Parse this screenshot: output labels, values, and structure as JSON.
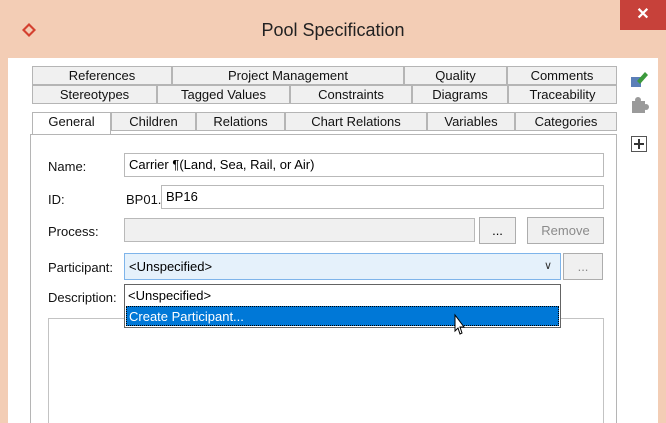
{
  "window": {
    "title": "Pool Specification",
    "close_glyph": "✕",
    "icon": "diamond-app-icon",
    "accent_color": "#d4402f"
  },
  "tabs": {
    "row1": [
      "References",
      "Project Management",
      "Quality",
      "Comments"
    ],
    "row2": [
      "Stereotypes",
      "Tagged Values",
      "Constraints",
      "Diagrams",
      "Traceability"
    ],
    "row3": [
      "General",
      "Children",
      "Relations",
      "Chart Relations",
      "Variables",
      "Categories"
    ],
    "active": "General"
  },
  "form": {
    "name_label": "Name:",
    "name_value": "Carrier ¶(Land, Sea, Rail, or Air)",
    "id_label": "ID:",
    "id_prefix": "BP01.",
    "id_value": "BP16",
    "process_label": "Process:",
    "process_value": "",
    "browse_label": "...",
    "remove_label": "Remove",
    "participant_label": "Participant:",
    "participant_value": "<Unspecified>",
    "participant_browse_label": "...",
    "description_label": "Description:"
  },
  "dropdown": {
    "options": [
      "<Unspecified>",
      "Create Participant..."
    ],
    "highlighted": "Create Participant..."
  },
  "side_tools": [
    "edit-icon",
    "puzzle-icon",
    "add-icon"
  ],
  "colors": {
    "title_bar": "#f3cdb5",
    "close_button": "#c7413a",
    "selection": "#0078d7"
  }
}
